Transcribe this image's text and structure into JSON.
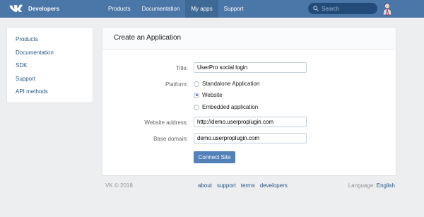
{
  "header": {
    "brand": "Developers",
    "nav": [
      "Products",
      "Documentation",
      "My apps",
      "Support"
    ],
    "active_nav": "My apps",
    "search_placeholder": "Search"
  },
  "sidebar": {
    "items": [
      {
        "label": "Products"
      },
      {
        "label": "Documentation"
      },
      {
        "label": "SDK"
      },
      {
        "label": "Support"
      },
      {
        "label": "API methods"
      }
    ]
  },
  "form": {
    "heading": "Create an Application",
    "title_label": "Title:",
    "title_value": "UserPro social login",
    "platform_label": "Platform:",
    "platforms": [
      {
        "label": "Standalone Application",
        "checked": false
      },
      {
        "label": "Website",
        "checked": true
      },
      {
        "label": "Embedded application",
        "checked": false
      }
    ],
    "website_label": "Website address:",
    "website_value": "http://demo.userproplugin.com",
    "domain_label": "Base domain:",
    "domain_value": "demo.userproplugin.com",
    "submit_label": "Connect Site"
  },
  "footer": {
    "copyright": "VK © 2018",
    "links": [
      "about",
      "support",
      "terms",
      "developers"
    ],
    "language_label": "Language:",
    "language_value": "English"
  },
  "colors": {
    "header_bg": "#4a76a8",
    "link": "#2a5885",
    "button": "#5181b8",
    "page_bg": "#edeef0"
  },
  "icons": [
    "vk-logo-icon",
    "search-icon",
    "avatar-icon"
  ]
}
